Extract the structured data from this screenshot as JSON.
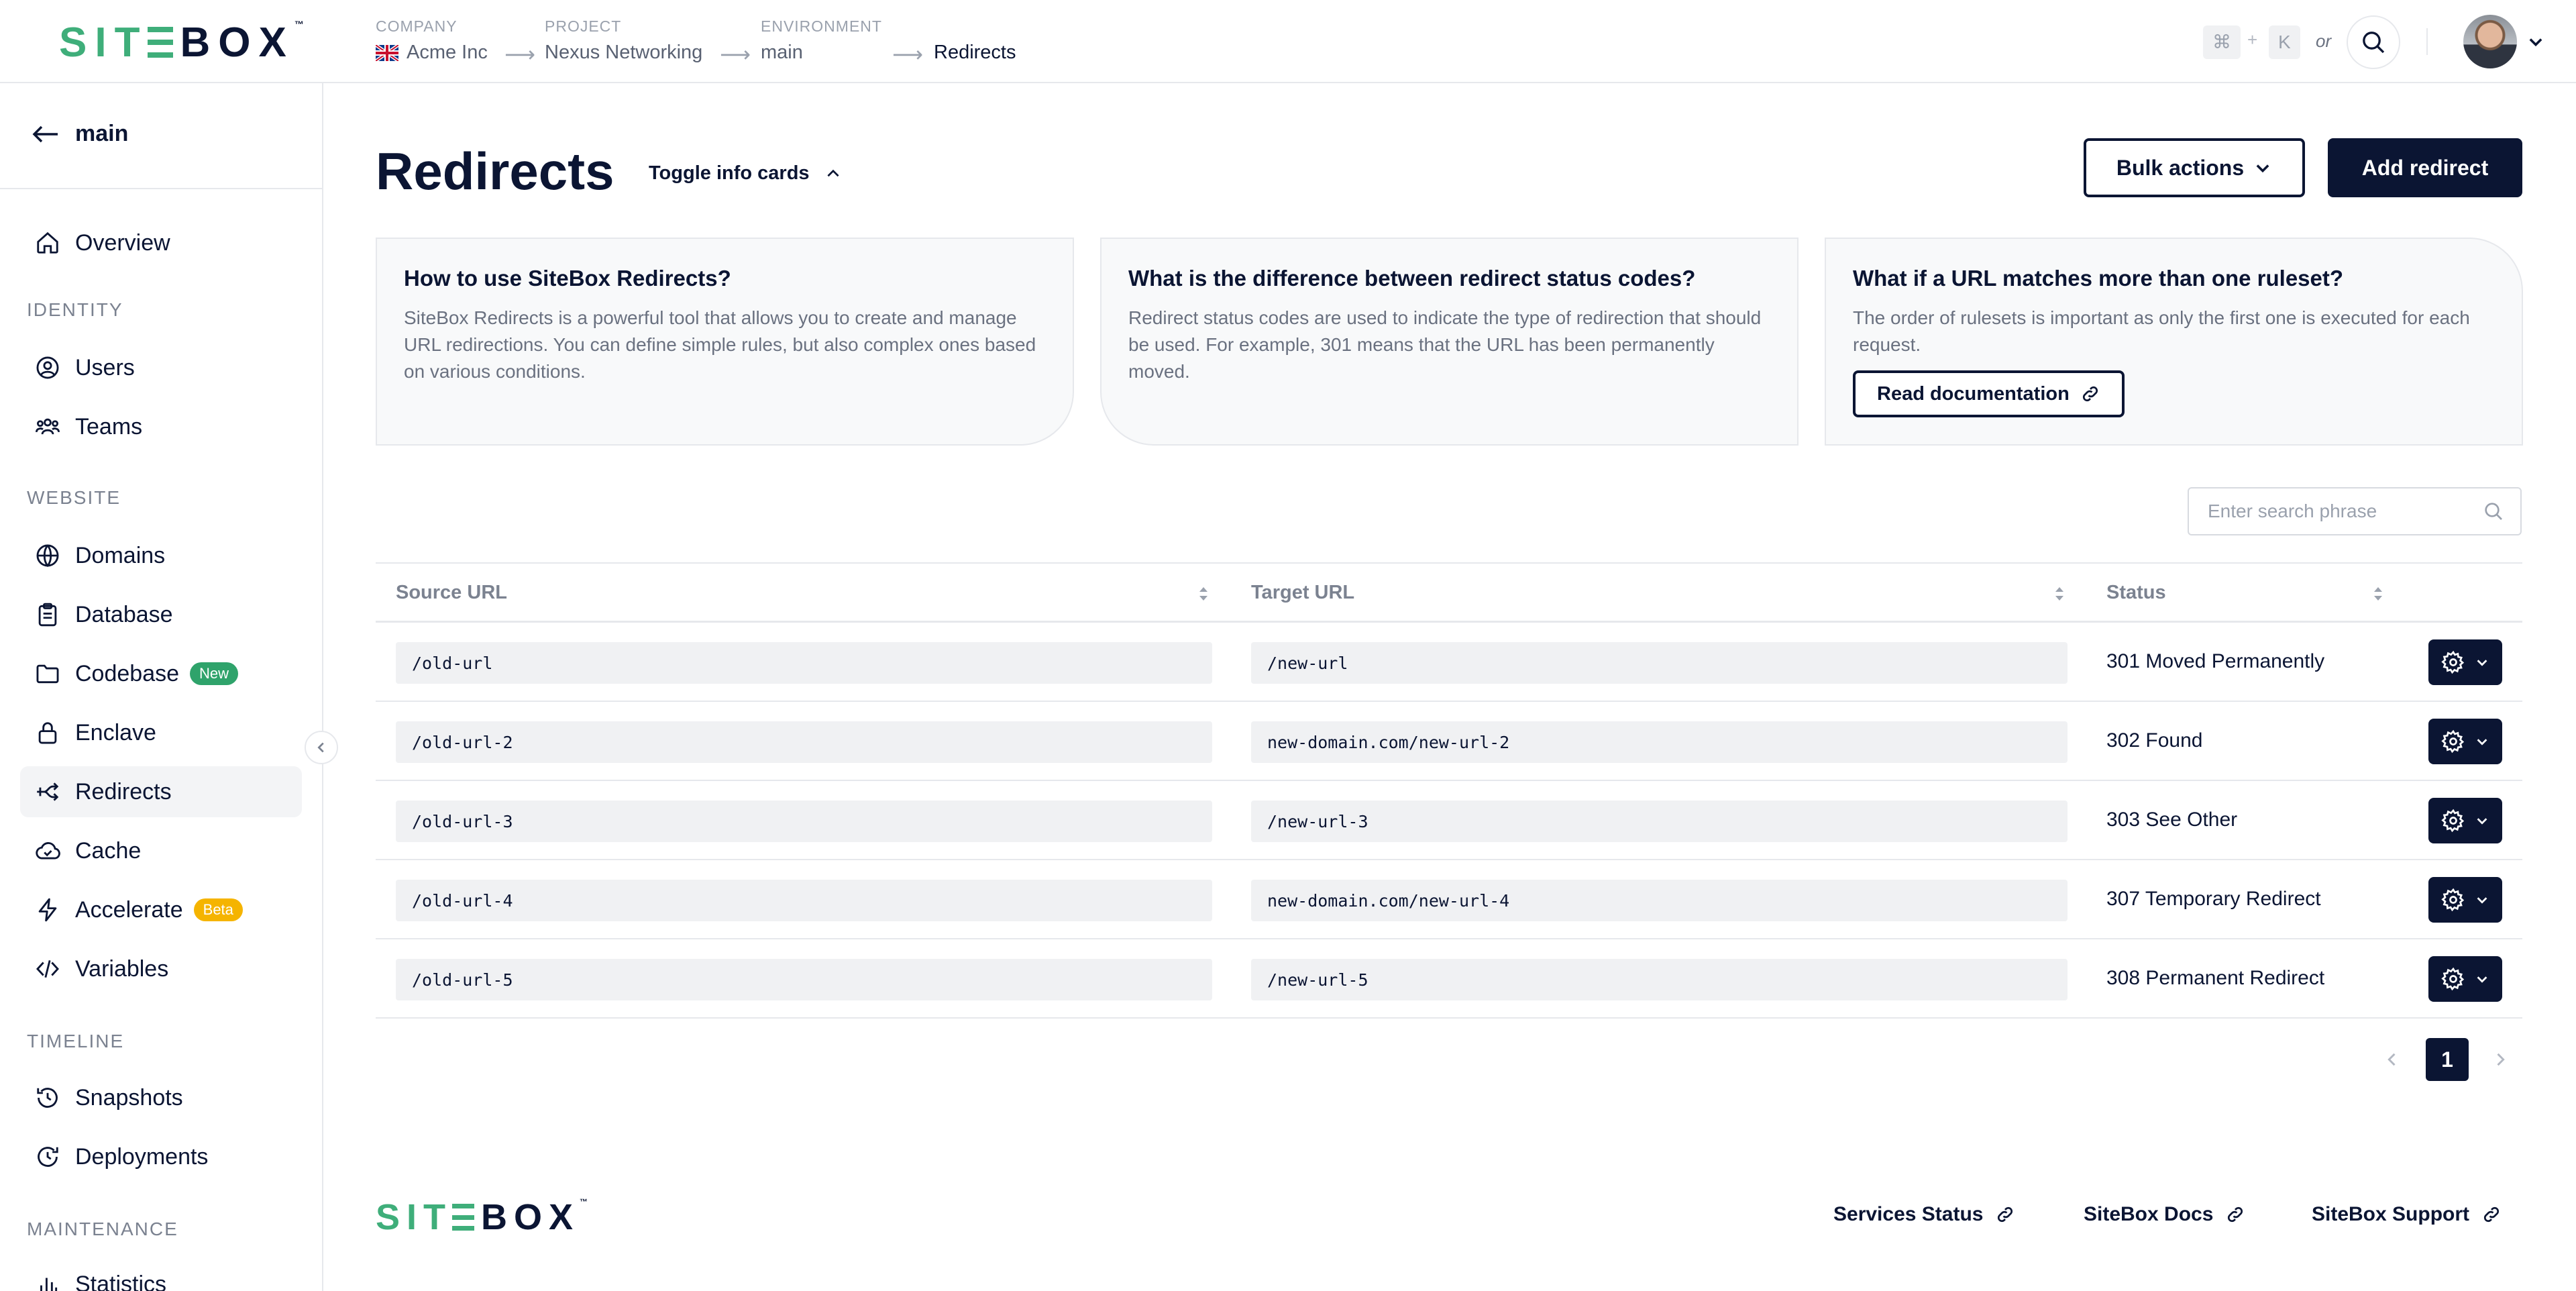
{
  "brand": {
    "logo_green": "SIT",
    "logo_dark": "BOX",
    "trademark": "™"
  },
  "header": {
    "breadcrumbs": [
      {
        "label": "COMPANY",
        "value": "Acme Inc"
      },
      {
        "label": "PROJECT",
        "value": "Nexus Networking"
      },
      {
        "label": "ENVIRONMENT",
        "value": "main"
      },
      {
        "label": "",
        "value": "Redirects"
      }
    ],
    "shortcut": {
      "key1": "⌘",
      "plus": "+",
      "key2": "K",
      "or": "or"
    }
  },
  "sidebar": {
    "back_label": "main",
    "sections": [
      {
        "title": "",
        "items": [
          "Overview"
        ]
      },
      {
        "title": "IDENTITY",
        "items": [
          "Users",
          "Teams"
        ]
      },
      {
        "title": "WEBSITE",
        "items": [
          "Domains",
          "Database",
          "Codebase",
          "Enclave",
          "Redirects",
          "Cache",
          "Accelerate",
          "Variables"
        ]
      },
      {
        "title": "TIMELINE",
        "items": [
          "Snapshots",
          "Deployments"
        ]
      },
      {
        "title": "MAINTENANCE",
        "items": [
          "Statistics"
        ]
      }
    ],
    "badges": {
      "codebase": "New",
      "accelerate": "Beta"
    },
    "active_item": "Redirects"
  },
  "main": {
    "title": "Redirects",
    "toggle_label": "Toggle info cards",
    "bulk_label": "Bulk actions",
    "add_label": "Add redirect",
    "cards": [
      {
        "title": "How to use SiteBox Redirects?",
        "text": "SiteBox Redirects is a powerful tool that allows you to create and manage URL redirections. You can define simple rules, but also complex ones based on various conditions."
      },
      {
        "title": "What is the difference between redirect status codes?",
        "text": "Redirect status codes are used to indicate the type of redirection that should be used. For example, 301 means that the URL has been permanently moved."
      },
      {
        "title": "What if a URL matches more than one ruleset?",
        "text": "The order of rulesets is important as only the first one is executed for each request.",
        "link": "Read documentation"
      }
    ],
    "search_placeholder": "Enter search phrase",
    "table": {
      "headers": {
        "source": "Source URL",
        "target": "Target URL",
        "status": "Status"
      },
      "rows": [
        {
          "source": "/old-url",
          "target": "/new-url",
          "status": "301 Moved Permanently"
        },
        {
          "source": "/old-url-2",
          "target": "new-domain.com/new-url-2",
          "status": "302 Found"
        },
        {
          "source": "/old-url-3",
          "target": "/new-url-3",
          "status": "303 See Other"
        },
        {
          "source": "/old-url-4",
          "target": "new-domain.com/new-url-4",
          "status": "307 Temporary Redirect"
        },
        {
          "source": "/old-url-5",
          "target": "/new-url-5",
          "status": "308 Permanent Redirect"
        }
      ]
    },
    "pagination": {
      "current": "1"
    }
  },
  "footer": {
    "links": [
      "Services Status",
      "SiteBox Docs",
      "SiteBox Support"
    ]
  },
  "colors": {
    "brand_green": "#3fae7a",
    "navy": "#0b1533",
    "badge_new": "#2fa36b",
    "badge_beta": "#f5b400"
  }
}
